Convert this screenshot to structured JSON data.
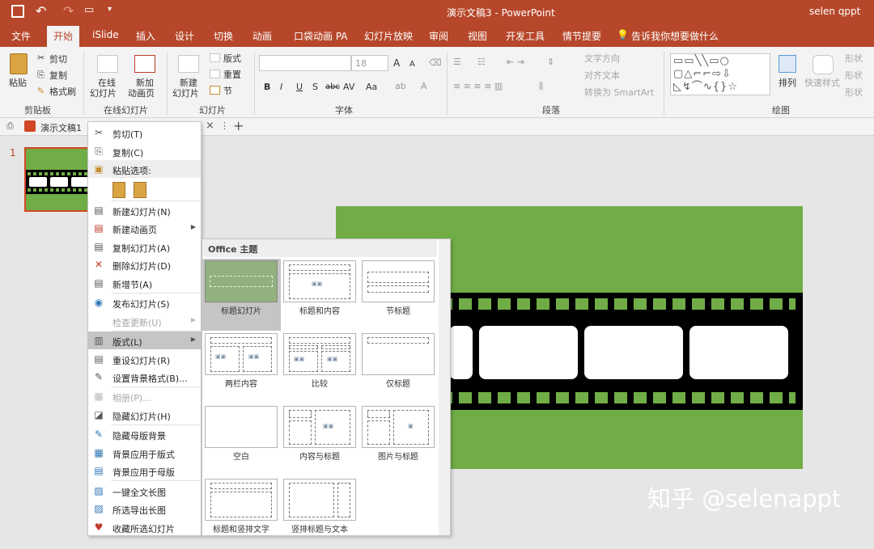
{
  "titlebar": {
    "title": "演示文稿3  -  PowerPoint",
    "user": "selen qppt"
  },
  "tabs": [
    "文件",
    "开始",
    "iSlide",
    "插入",
    "设计",
    "切换",
    "动画",
    "口袋动画 PA",
    "幻灯片放映",
    "审阅",
    "视图",
    "开发工具",
    "情节提要"
  ],
  "active_tab": "开始",
  "tell_me": "告诉我你想要做什么",
  "ribbon": {
    "clipboard": {
      "paste": "粘贴",
      "cut": "剪切",
      "copy": "复制",
      "format_painter": "格式刷",
      "group": "剪贴板"
    },
    "online_slides": {
      "online": "在线",
      "online2": "幻灯片",
      "new_anim": "新加",
      "new_anim2": "动画页",
      "group": "在线幻灯片"
    },
    "slides": {
      "new": "新建",
      "new2": "幻灯片",
      "layout": "版式",
      "reset": "重置",
      "section": "节",
      "group": "幻灯片"
    },
    "font": {
      "size": "18",
      "group": "字体",
      "bold": "B",
      "italic": "I",
      "underline": "U",
      "shadow": "S",
      "strike": "abc",
      "spacing": "AV",
      "case": "Aa",
      "grow": "A",
      "shrink": "A"
    },
    "paragraph": {
      "text_direction": "文字方向",
      "align_text": "对齐文本",
      "smartart": "转换为 SmartArt",
      "group": "段落"
    },
    "drawing": {
      "arrange": "排列",
      "quick_styles": "快速样式",
      "shape_fill": "形状",
      "shape_outline": "形状",
      "shape_effects": "形状",
      "group": "绘图"
    }
  },
  "doc_tab": {
    "name": "演示文稿1",
    "close": "×",
    "plus": "+"
  },
  "thumbnail": {
    "number": "1"
  },
  "context_menu": {
    "items": [
      {
        "label": "剪切(T)",
        "icon": "scissors-icon",
        "glyph": "✂"
      },
      {
        "label": "复制(C)",
        "icon": "copy-icon",
        "glyph": "⎘"
      },
      {
        "label": "粘贴选项:",
        "icon": "paste-icon",
        "glyph": "📋"
      },
      {
        "label": "新建幻灯片(N)",
        "icon": "new-slide-icon",
        "glyph": "▤"
      },
      {
        "label": "新建动画页",
        "icon": "new-anim-icon",
        "glyph": "▤"
      },
      {
        "label": "复制幻灯片(A)",
        "icon": "duplicate-slide-icon",
        "glyph": "▤"
      },
      {
        "label": "删除幻灯片(D)",
        "icon": "delete-slide-icon",
        "glyph": "✕"
      },
      {
        "label": "新增节(A)",
        "icon": "new-section-icon",
        "glyph": "▤"
      },
      {
        "label": "发布幻灯片(S)",
        "icon": "publish-icon",
        "glyph": "◉"
      },
      {
        "label": "检查更新(U)",
        "icon": "update-icon",
        "glyph": ""
      },
      {
        "label": "版式(L)",
        "icon": "layout-icon",
        "glyph": "▥"
      },
      {
        "label": "重设幻灯片(R)",
        "icon": "reset-icon",
        "glyph": "▤"
      },
      {
        "label": "设置背景格式(B)...",
        "icon": "background-icon",
        "glyph": "✎"
      },
      {
        "label": "相册(P)...",
        "icon": "album-icon",
        "glyph": "▦"
      },
      {
        "label": "隐藏幻灯片(H)",
        "icon": "hide-slide-icon",
        "glyph": "◪"
      },
      {
        "label": "隐藏母版背景",
        "icon": "hide-master-icon",
        "glyph": "✎"
      },
      {
        "label": "背景应用于版式",
        "icon": "bg-layout-icon",
        "glyph": "▦"
      },
      {
        "label": "背景应用于母版",
        "icon": "bg-master-icon",
        "glyph": "▤"
      },
      {
        "label": "一键全文长图",
        "icon": "long-image-icon",
        "glyph": "▨"
      },
      {
        "label": "所选导出长图",
        "icon": "export-image-icon",
        "glyph": "▨"
      },
      {
        "label": "收藏所选幻灯片",
        "icon": "favorite-icon",
        "glyph": "♥"
      }
    ]
  },
  "layout_gallery": {
    "header": "Office 主题",
    "layouts": [
      "标题幻灯片",
      "标题和内容",
      "节标题",
      "两栏内容",
      "比较",
      "仅标题",
      "空白",
      "内容与标题",
      "图片与标题",
      "标题和竖排文字",
      "竖排标题与文本"
    ],
    "selected": "标题幻灯片"
  },
  "colors": {
    "accent": "#b7472a",
    "slide_green": "#70ad47",
    "film": "#000000",
    "hover": "#c5c5c5"
  },
  "watermark": "知乎 @selenappt"
}
